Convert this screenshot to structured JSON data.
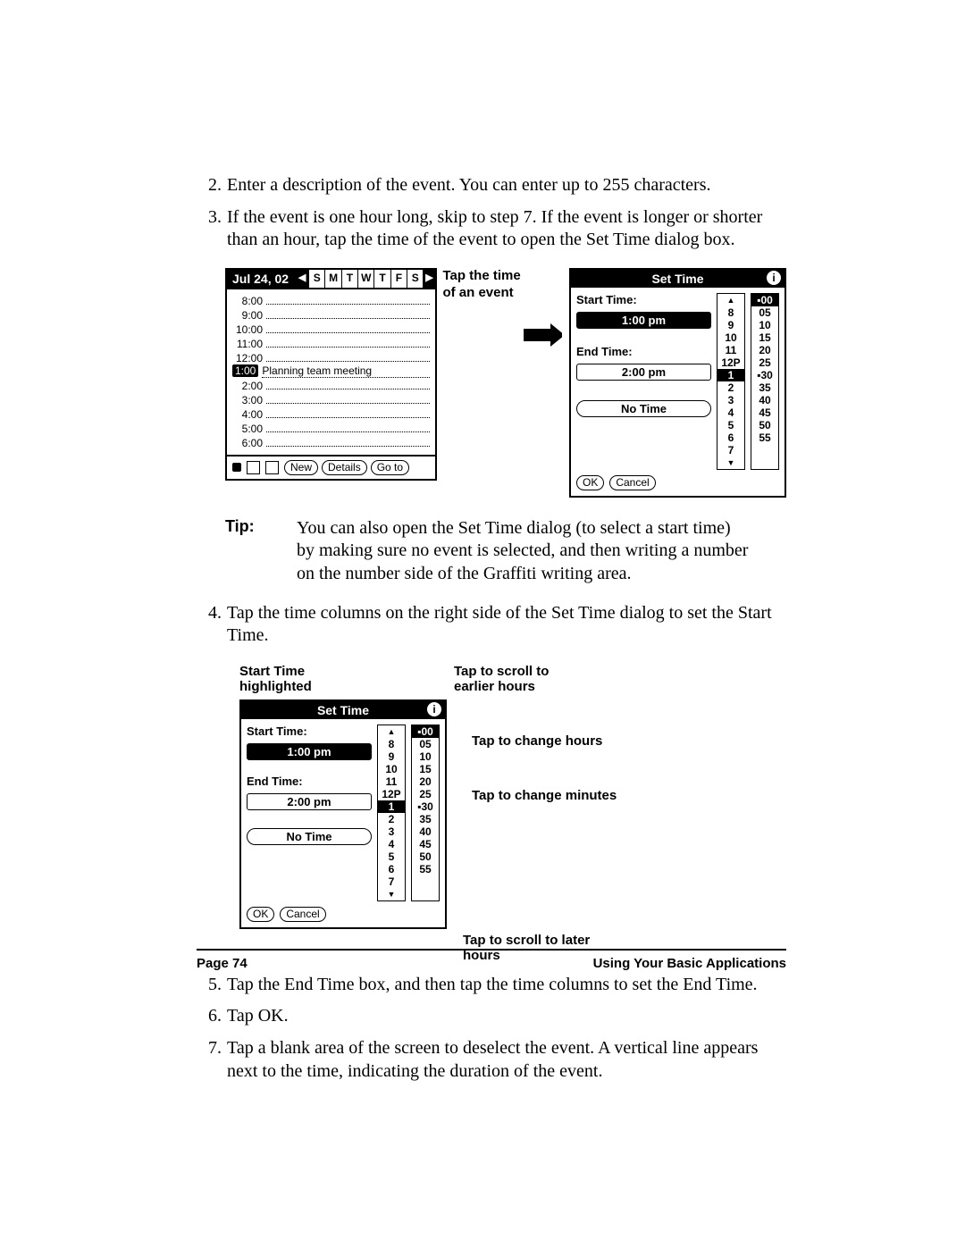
{
  "steps": {
    "s2": {
      "num": "2.",
      "text": "Enter a description of the event. You can enter up to 255 characters."
    },
    "s3": {
      "num": "3.",
      "text": "If the event is one hour long, skip to step 7. If the event is longer or shorter than an hour, tap the time of the event to open the Set Time dialog box."
    },
    "s4": {
      "num": "4.",
      "text": "Tap the time columns on the right side of the Set Time dialog to set the Start Time."
    },
    "s5": {
      "num": "5.",
      "text": "Tap the End Time box, and then tap the time columns to set the End Time."
    },
    "s6": {
      "num": "6.",
      "text": "Tap OK."
    },
    "s7": {
      "num": "7.",
      "text": "Tap a blank area of the screen to deselect the event. A vertical line appears next to the time, indicating the duration of the event."
    }
  },
  "tip": {
    "label": "Tip:",
    "text": "You can also open the Set Time dialog (to select a start time) by making sure no event is selected, and then writing a number on the number side of the Graffiti writing area."
  },
  "fig1": {
    "callout": "Tap the time of an event",
    "datebook": {
      "date": "Jul 24, 02",
      "days": [
        "S",
        "M",
        "T",
        "W",
        "T",
        "F",
        "S"
      ],
      "rows": [
        "8:00",
        "9:00",
        "10:00",
        "11:00",
        "12:00"
      ],
      "sel_time": "1:00",
      "sel_text": "Planning team meeting",
      "rows2": [
        "2:00",
        "3:00",
        "4:00",
        "5:00",
        "6:00"
      ],
      "buttons": {
        "new": "New",
        "details": "Details",
        "goto": "Go to"
      }
    },
    "settime": {
      "title": "Set Time",
      "start_label": "Start Time:",
      "start_val": "1:00 pm",
      "end_label": "End Time:",
      "end_val": "2:00 pm",
      "notime": "No Time",
      "ok": "OK",
      "cancel": "Cancel",
      "hours": [
        "8",
        "9",
        "10",
        "11",
        "12P",
        "1",
        "2",
        "3",
        "4",
        "5",
        "6",
        "7"
      ],
      "hour_sel_index": 5,
      "mins": [
        "▪00",
        "05",
        "10",
        "15",
        "20",
        "25",
        "▪30",
        "35",
        "40",
        "45",
        "50",
        "55"
      ],
      "min_sel_index": 0
    }
  },
  "fig2": {
    "top_left": "Start Time highlighted",
    "top_right": "Tap to scroll to earlier hours",
    "right1": "Tap to change hours",
    "right2": "Tap to change minutes",
    "bottom": "Tap to scroll to later hours"
  },
  "footer": {
    "left": "Page 74",
    "right": "Using Your Basic Applications"
  }
}
